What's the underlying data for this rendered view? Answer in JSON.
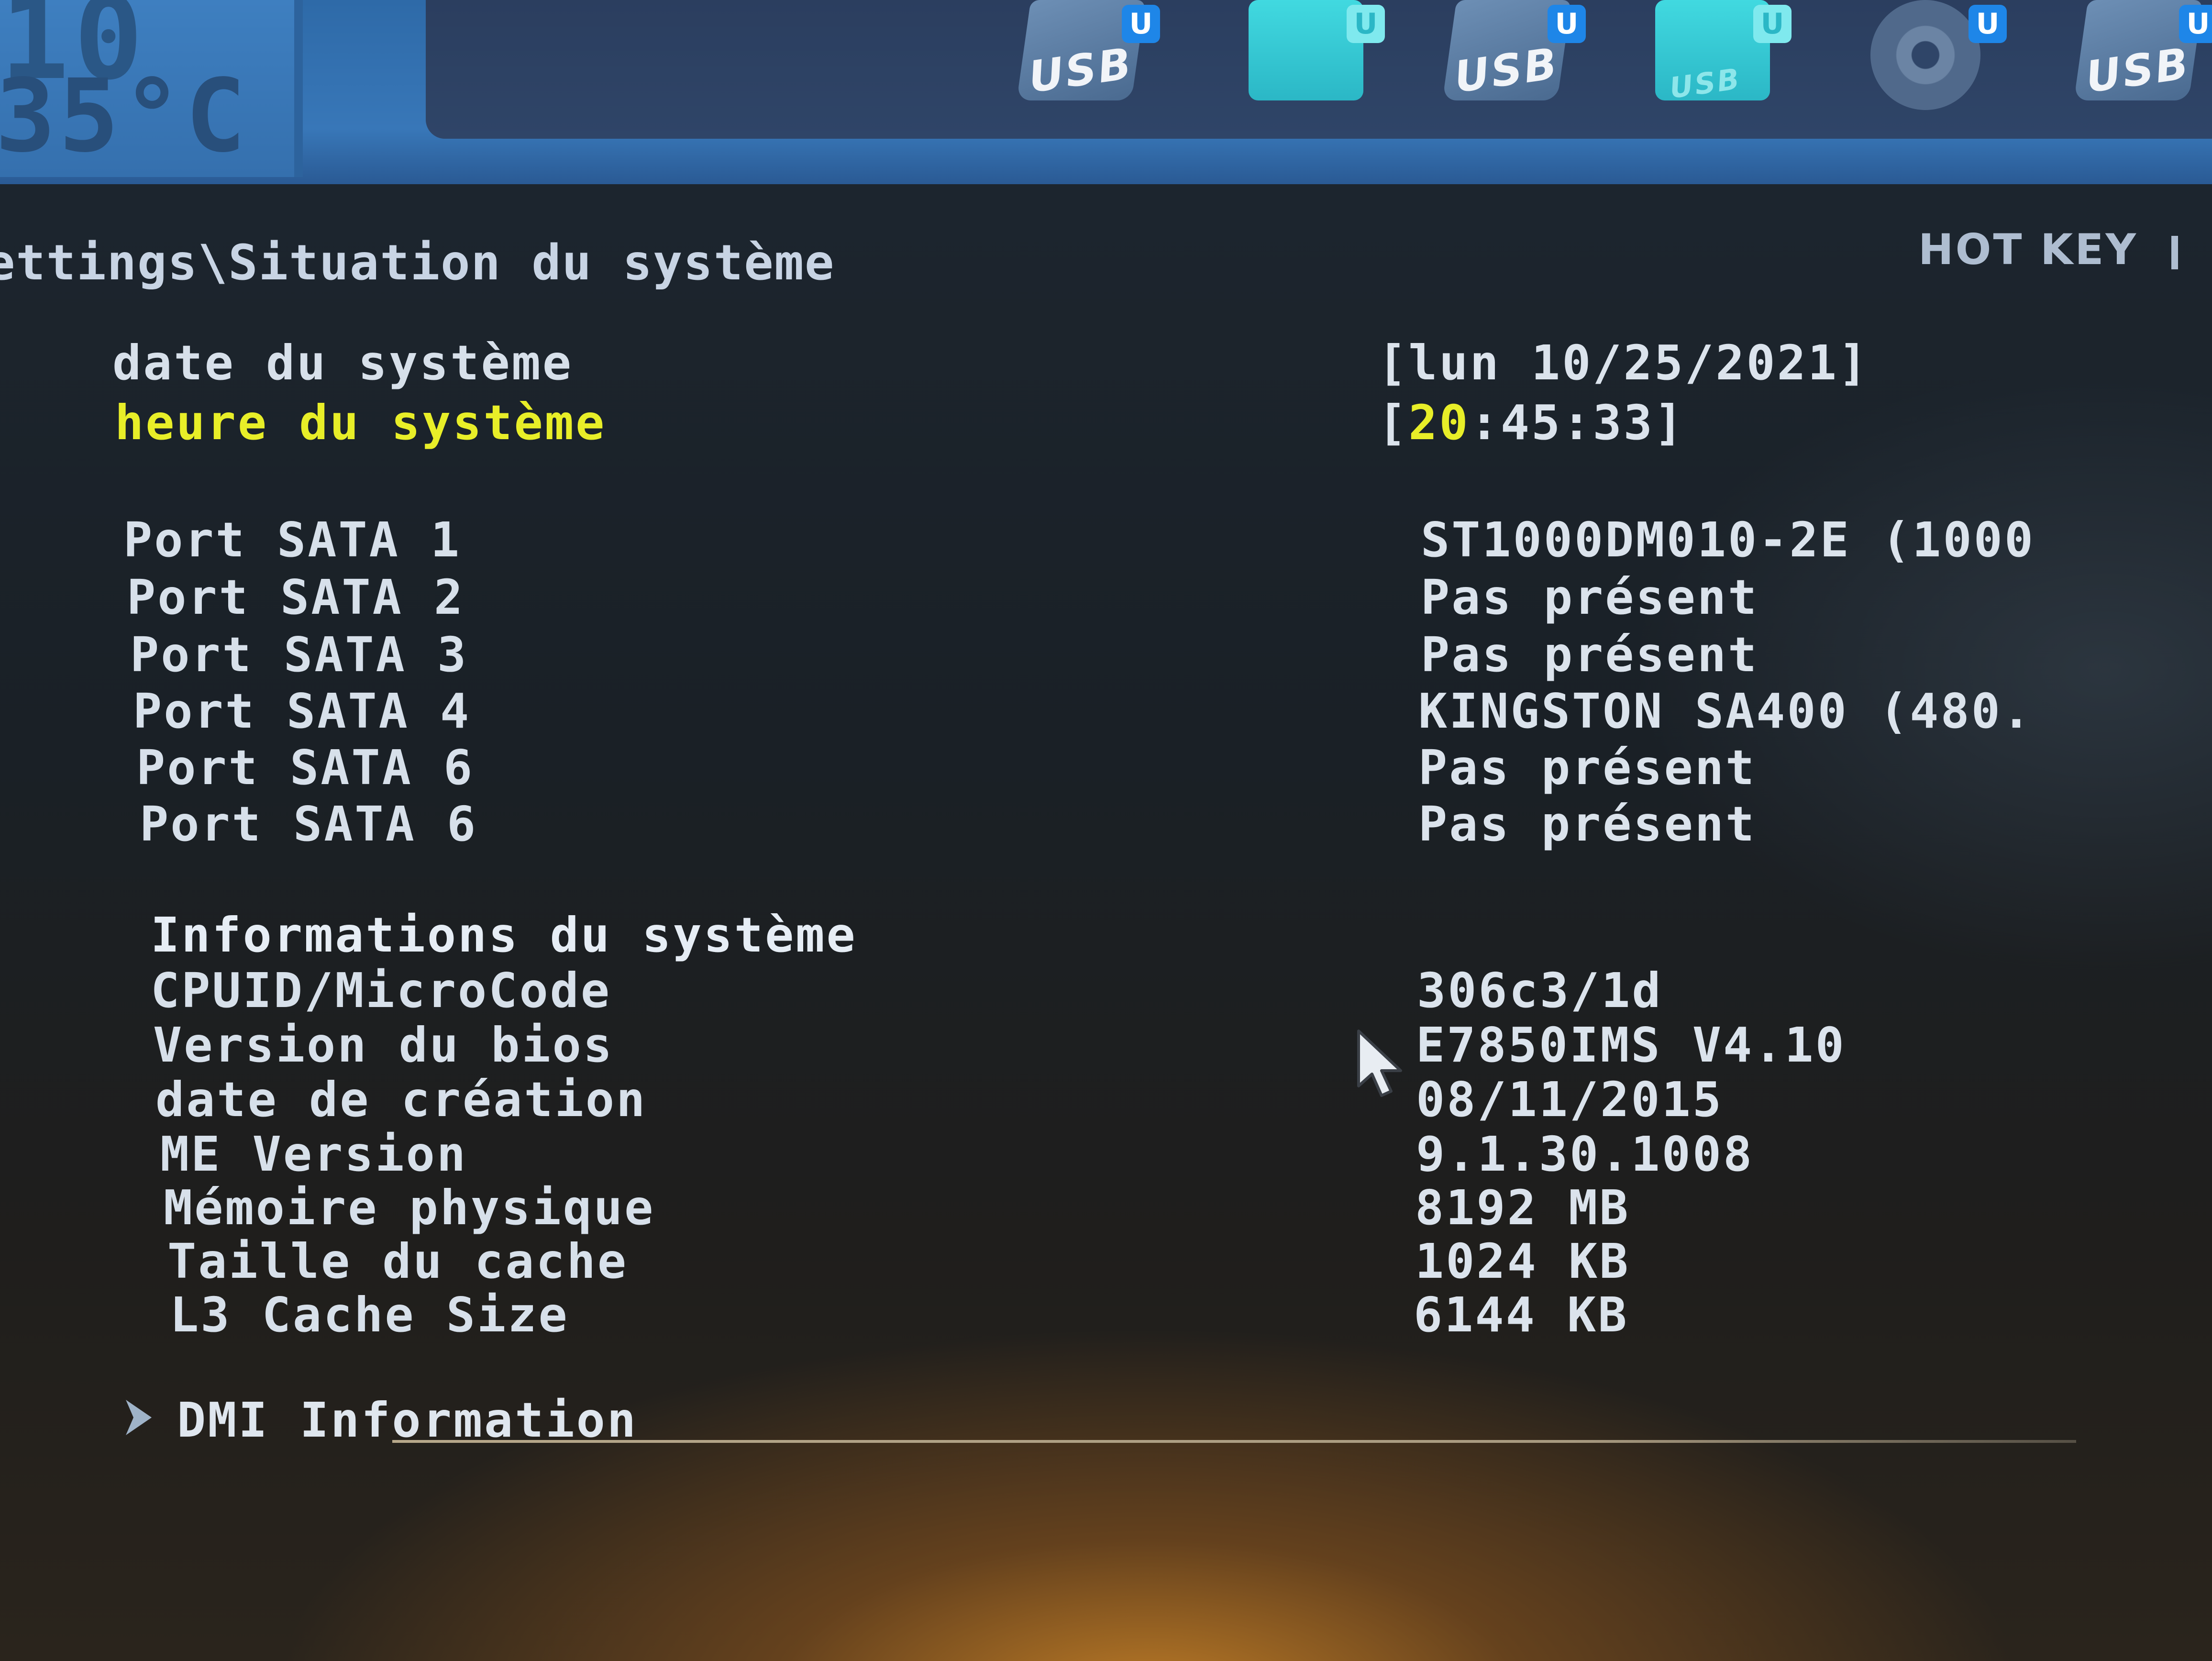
{
  "header": {
    "temp_top": "10",
    "temp_value": "35°C",
    "boot_devices": [
      {
        "label": "USB",
        "badge": "U"
      },
      {
        "label": "",
        "badge": "U"
      },
      {
        "label": "USB",
        "badge": "U"
      },
      {
        "label": "USB",
        "badge": "U"
      },
      {
        "label": "",
        "badge": "U"
      },
      {
        "label": "USB",
        "badge": "U"
      }
    ]
  },
  "breadcrumb": "ettings\\Situation du système",
  "hotkey": "HOT KEY",
  "system": {
    "date_label": "date du système",
    "date_value": "[lun 10/25/2021]",
    "time_label": "heure du système",
    "time_open": "[",
    "time_hour": "20",
    "time_rest": ":45:33]"
  },
  "sata_ports": [
    {
      "label": "Port SATA 1",
      "value": "ST1000DM010-2E (1000"
    },
    {
      "label": "Port SATA 2",
      "value": "Pas présent"
    },
    {
      "label": "Port SATA 3",
      "value": "Pas présent"
    },
    {
      "label": "Port SATA 4",
      "value": "KINGSTON SA400 (480."
    },
    {
      "label": "Port SATA 6",
      "value": "Pas présent"
    },
    {
      "label": "Port SATA 6",
      "value": "Pas présent"
    }
  ],
  "info": {
    "title": "Informations du système",
    "rows": [
      {
        "label": "CPUID/MicroCode",
        "value": "306c3/1d"
      },
      {
        "label": "Version du bios",
        "value": "E7850IMS V4.10"
      },
      {
        "label": "date de création",
        "value": "08/11/2015"
      },
      {
        "label": "ME Version",
        "value": "9.1.30.1008"
      },
      {
        "label": "Mémoire physique",
        "value": "8192 MB"
      },
      {
        "label": "Taille du cache",
        "value": "1024 KB"
      },
      {
        "label": "L3 Cache Size",
        "value": "6144 KB"
      }
    ]
  },
  "dmi": {
    "label": "DMI Information",
    "icon": "chevron-right-icon"
  },
  "colors": {
    "header_blue": "#3877b8",
    "selected_yellow": "#e8ee28",
    "text": "#d7e0ea"
  }
}
